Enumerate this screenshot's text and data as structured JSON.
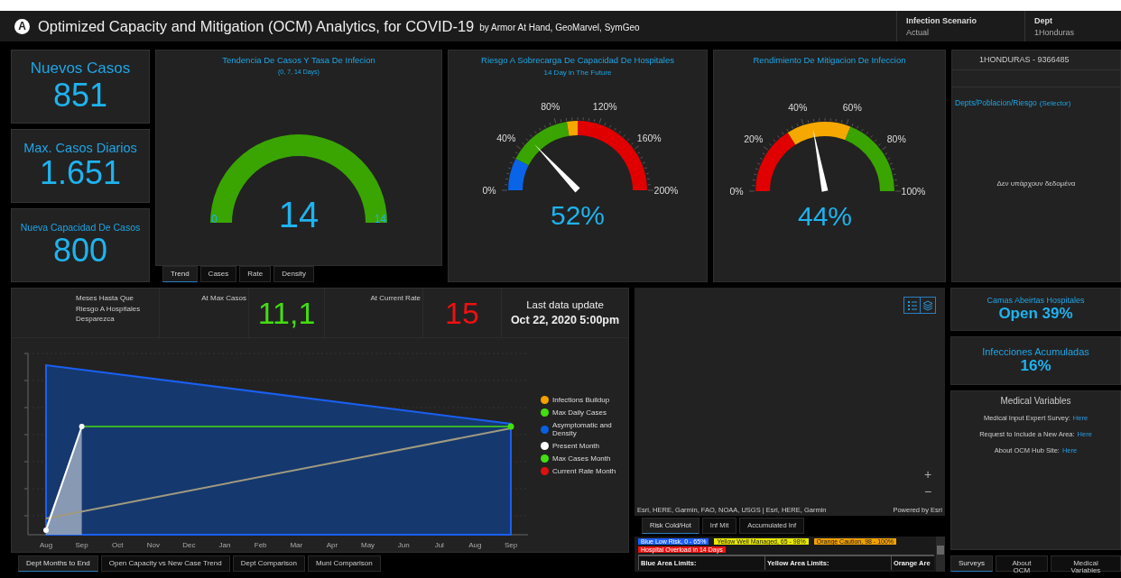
{
  "header": {
    "logo": "A",
    "title": "Optimized Capacity and Mitigation (OCM) Analytics, for COVID-19",
    "byline": "by Armor At Hand, GeoMarvel, SymGeo",
    "fields": [
      {
        "label": "Infection Scenario",
        "value": "Actual"
      },
      {
        "label": "Dept",
        "value": "1Honduras"
      }
    ]
  },
  "kpis": [
    {
      "label": "Nuevos Casos",
      "value": "851"
    },
    {
      "label": "Max. Casos Diarios",
      "value": "1.651"
    },
    {
      "label": "Nueva Capacidad De Casos",
      "value": "800"
    }
  ],
  "gauges": [
    {
      "kind": "solid",
      "title": "Tendencia De Casos Y Tasa De Infecion",
      "subtitle": "(0, 7, 14 Days)",
      "min_label": "0",
      "max_label": "14",
      "value": "14",
      "color": "#3aa500",
      "tabs": [
        {
          "label": "Trend",
          "selected": true
        },
        {
          "label": "Cases",
          "selected": false
        },
        {
          "label": "Rate",
          "selected": false
        },
        {
          "label": "Density",
          "selected": false
        }
      ]
    },
    {
      "kind": "dial",
      "title": "Riesgo A Sobrecarga De Capacidad De Hospitales",
      "subtitle": "14 Day in The Future",
      "value": "52%",
      "tick_labels": [
        "0%",
        "40%",
        "80%",
        "120%",
        "160%",
        "200%"
      ],
      "bands": [
        {
          "color": "#0a64e8"
        },
        {
          "color": "#3aa500"
        },
        {
          "color": "#f5a800"
        },
        {
          "color": "#e00000"
        }
      ]
    },
    {
      "kind": "dial",
      "title": "Rendimiento De Mitigacion De Infeccion",
      "value": "44%",
      "tick_labels": [
        "0%",
        "20%",
        "40%",
        "60%",
        "80%",
        "100%"
      ],
      "bands": [
        {
          "color": "#e00000"
        },
        {
          "color": "#f5a800"
        },
        {
          "color": "#3aa500"
        }
      ]
    }
  ],
  "selector": {
    "header": "1HONDURAS - 9366485",
    "title": "Depts/Poblacion/Riesgo",
    "hint": "(Selector)",
    "empty": "Δεν υπάρχουν δεδομένα"
  },
  "stats": {
    "risk_label": "Meses Hasta Que Riesgo A Hospitales Desparezca",
    "max_label": "At Max Casos",
    "max_value": "11,1",
    "rate_label": "At Current Rate",
    "rate_value": "15",
    "update_label": "Last data update",
    "update_value": "Oct 22, 2020 5:00pm"
  },
  "chart": {
    "x_labels": [
      "Aug",
      "Sep",
      "Oct",
      "Nov",
      "Dec",
      "Jan",
      "Feb",
      "Mar",
      "Apr",
      "May",
      "Jun",
      "Jul",
      "Aug",
      "Sep"
    ],
    "legend": [
      {
        "label": "Infections Buildup",
        "color": "#f5a000"
      },
      {
        "label": "Max Daily Cases",
        "color": "#44dd11"
      },
      {
        "label": "Asymptomatic and Density",
        "color": "#0a5ee0"
      },
      {
        "label": "Present Month",
        "color": "#ffffff"
      },
      {
        "label": "Max Cases Month",
        "color": "#44dd11"
      },
      {
        "label": "Current Rate Month",
        "color": "#dd1111"
      }
    ],
    "tabs": [
      {
        "label": "Dept Months to End",
        "selected": true
      },
      {
        "label": "Open Capacity vs New Case Trend",
        "selected": false
      },
      {
        "label": "Dept Comparison",
        "selected": false
      },
      {
        "label": "Muni Comparison",
        "selected": false
      }
    ]
  },
  "map": {
    "zoom_in": "+",
    "zoom_out": "−",
    "attribution": "Esri, HERE, Garmin, FAO, NOAA, USGS | Esri, HERE, Garmin",
    "powered": "Powered by Esri",
    "tabs": [
      {
        "label": "Risk Cold/Hot",
        "selected": true
      },
      {
        "label": "Inf Mit",
        "selected": false
      },
      {
        "label": "Accumulated Inf",
        "selected": false
      }
    ],
    "legend": [
      {
        "label": "Blue Low Risk, 0 - 65%",
        "color": "#1a5cff"
      },
      {
        "label": "Yellow Well Managed, 65 - 98%",
        "color": "#e8e800"
      },
      {
        "label": "Orange Caution, 98 - 100%",
        "color": "#f0a000"
      },
      {
        "label": "Hospital Overload in 14 Days",
        "color": "#ee1111"
      }
    ],
    "columns": [
      "Blue Area Limits:",
      "Yellow Area Limits:",
      "Orange Are"
    ]
  },
  "cards": [
    {
      "label": "Camas Abeirtas Hospitales",
      "value": "Open 39%"
    },
    {
      "label": "Infecciones Acumuladas",
      "value": "16%"
    }
  ],
  "medical": {
    "title": "Medical Variables",
    "lines": [
      {
        "label": "Medical Input Expert Survey:",
        "link": "Here"
      },
      {
        "label": "Request to Include a New Area:",
        "link": "Here"
      },
      {
        "label": "About OCM Hub Site:",
        "link": "Here"
      }
    ]
  },
  "right_tabs": [
    {
      "label": "Surveys",
      "selected": true
    },
    {
      "label": "About OCM",
      "selected": false
    },
    {
      "label": "Medical Variables",
      "selected": false
    }
  ]
}
